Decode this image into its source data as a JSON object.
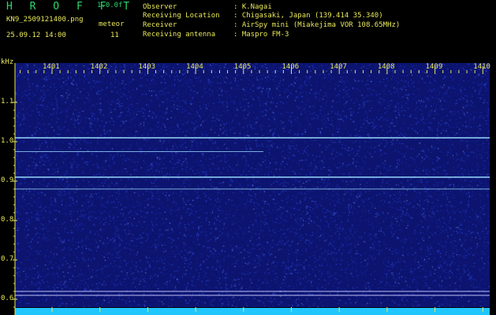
{
  "app": {
    "name": "H R O F F T",
    "version": "1.0.0f",
    "filename": "KN9_2509121400.png",
    "mode": "meteor",
    "datetime": "25.09.12 14:00",
    "count": "11"
  },
  "info": {
    "observer_label": "Observer",
    "observer_value": ": K.Nagai",
    "location_label": "Receiving Location",
    "location_value": ": Chigasaki, Japan (139.414 35.340)",
    "receiver_label": "Receiver",
    "receiver_value": ": AirSpy mini (Miakejima VOR 108.65MHz)",
    "antenna_label": "Receiving antenna",
    "antenna_value": ": Maspro FM-3"
  },
  "spectrogram": {
    "y_unit": "kHz",
    "y_ticks": [
      "1.1",
      "1.0",
      "0.9",
      "0.8",
      "0.7",
      "0.6"
    ],
    "y_tick_values": [
      1.1,
      1.0,
      0.9,
      0.8,
      0.7,
      0.6
    ],
    "y_range": [
      0.58,
      1.2
    ],
    "x_ticks": [
      "1401",
      "1402",
      "1403",
      "1404",
      "1405",
      "1406",
      "1407",
      "1408",
      "1409",
      "1410"
    ],
    "carrier_lines_khz": [
      1.01,
      0.975,
      0.91,
      0.88,
      0.62,
      0.61
    ],
    "colors": {
      "background": "#0c1470",
      "noise": "#3a5cff",
      "carrier": "#9fe3ff",
      "axis": "#e8e85a",
      "bottom_band": "#22c6ff"
    }
  }
}
